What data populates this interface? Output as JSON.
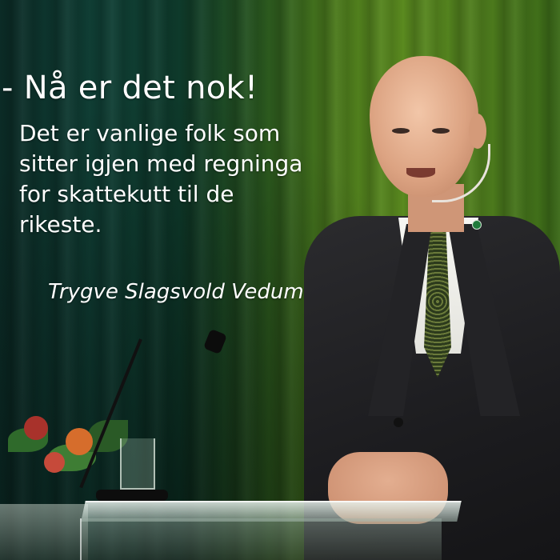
{
  "quote": {
    "headline": "- Nå er det nok!",
    "body_lines": [
      "Det er vanlige folk som",
      "sitter igjen med regninga",
      "for skattekutt til de",
      "rikeste."
    ],
    "attribution": "Trygve Slagsvold Vedum"
  },
  "colors": {
    "text": "#ffffff",
    "curtain_dark": "#0e3a2b",
    "curtain_light": "#5a8a1f",
    "suit": "#1c1c1f"
  }
}
